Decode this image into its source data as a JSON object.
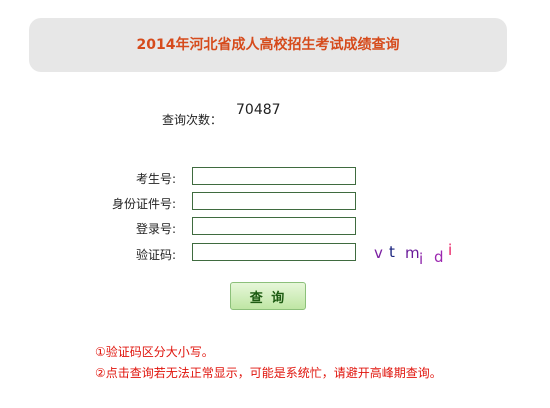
{
  "header": {
    "title": "2014年河北省成人高校招生考试成绩查询"
  },
  "query_count": {
    "label": "查询次数：",
    "value": "70487"
  },
  "form": {
    "exam_number_label": "考生号:",
    "id_number_label": "身份证件号:",
    "login_number_label": "登录号:",
    "captcha_label": "验证码:",
    "exam_number_value": "",
    "id_number_value": "",
    "login_number_value": "",
    "captcha_value": ""
  },
  "captcha_image": {
    "chars": [
      "v",
      "t",
      "m",
      "i",
      "d",
      "i"
    ],
    "colors": [
      "#7b1fa2",
      "#1a237e",
      "#6a1b9a",
      "#8e24aa",
      "#9c27b0",
      "#e91e63"
    ]
  },
  "submit": {
    "label": "查 询"
  },
  "notes": {
    "line1": "①验证码区分大小写。",
    "line2": "②点击查询若无法正常显示，可能是系统忙，请避开高峰期查询。"
  },
  "colors": {
    "title": "#d64b1c",
    "note": "#e0140c",
    "input_border": "#3f6b3f",
    "button_bg": "#bfe6a4"
  }
}
